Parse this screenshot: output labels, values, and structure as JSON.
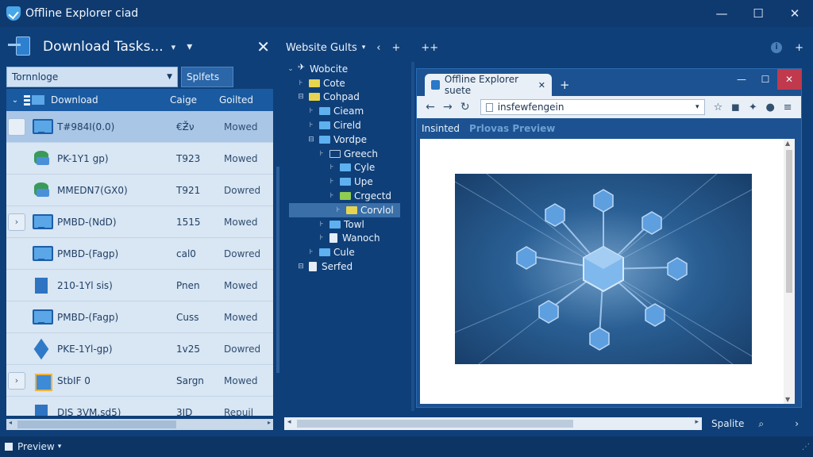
{
  "window": {
    "title": "Offline Explorer ciad",
    "controls": [
      "—",
      "☐",
      "✕"
    ]
  },
  "left_panel": {
    "title": "Download Tasks...",
    "dropdown_glyph": "▾",
    "more_glyph": "▾",
    "close_glyph": "✕",
    "filter_value": "Tornnloge",
    "status_button": "Splfets",
    "header": {
      "caret": "⌄",
      "name": "Download",
      "size": "Caige",
      "status": "Goilted"
    },
    "rows": [
      {
        "expander": "",
        "icon": "monitor",
        "name": "T#984I(0.0)",
        "size": "€Ƶ̌ν",
        "status": "Mowed",
        "selected": true
      },
      {
        "expander": "",
        "icon": "db",
        "name": "PK-1Y1 gp)",
        "size": "T923",
        "status": "Mowed",
        "selected": false
      },
      {
        "expander": "",
        "icon": "db",
        "name": "MMEDN7(GX0)",
        "size": "T921",
        "status": "Dowred",
        "selected": false
      },
      {
        "expander": "›",
        "icon": "monitor",
        "name": "PMBD-(NdD)",
        "size": "1515",
        "status": "Mowed",
        "selected": false
      },
      {
        "expander": "",
        "icon": "monitor",
        "name": "PMBD-(Fagp)",
        "size": "cal0",
        "status": "Dowred",
        "selected": false
      },
      {
        "expander": "",
        "icon": "doc",
        "name": "210-1Yl sis)",
        "size": "Pnen",
        "status": "Mowed",
        "selected": false
      },
      {
        "expander": "",
        "icon": "monitor",
        "name": "PMBD-(Fagp)",
        "size": "Cuss",
        "status": "Mowed",
        "selected": false
      },
      {
        "expander": "",
        "icon": "cube",
        "name": "PKE-1Yl-gp)",
        "size": "1v25",
        "status": "Dowred",
        "selected": false
      },
      {
        "expander": "›",
        "icon": "box",
        "name": "StbIF 0",
        "size": "Sargn",
        "status": "Mowed",
        "selected": false
      },
      {
        "expander": "",
        "icon": "doc",
        "name": "DIS 3VM.sd5)",
        "size": "3JD",
        "status": "Repuil",
        "selected": false
      }
    ]
  },
  "mid_toolbar": {
    "tab_label": "Website Gults",
    "dropdown_glyph": "▾",
    "back_glyph": "‹",
    "add_glyph": "+",
    "plusplus_glyph": "++",
    "info_glyph": "i",
    "add_right_glyph": "+"
  },
  "tree": [
    {
      "indent": 0,
      "expander": "⌄",
      "icon": "pin",
      "label": "Wobcite",
      "selected": false
    },
    {
      "indent": 1,
      "expander": "⊦",
      "icon": "y",
      "label": "Cote",
      "selected": false
    },
    {
      "indent": 1,
      "expander": "⊟",
      "icon": "y",
      "label": "Cohpad",
      "selected": false
    },
    {
      "indent": 2,
      "expander": "⊦",
      "icon": "b",
      "label": "Cieam",
      "selected": false
    },
    {
      "indent": 2,
      "expander": "⊦",
      "icon": "b",
      "label": "Cireld",
      "selected": false
    },
    {
      "indent": 2,
      "expander": "⊟",
      "icon": "b",
      "label": "Vordpe",
      "selected": false
    },
    {
      "indent": 3,
      "expander": "⊦",
      "icon": "o",
      "label": "Greech",
      "selected": false
    },
    {
      "indent": 4,
      "expander": "⊦",
      "icon": "b",
      "label": "Cyle",
      "selected": false
    },
    {
      "indent": 4,
      "expander": "⊦",
      "icon": "b",
      "label": "Upe",
      "selected": false
    },
    {
      "indent": 4,
      "expander": "⊦",
      "icon": "g",
      "label": "Crgectd",
      "selected": false
    },
    {
      "indent": 4,
      "expander": "⊦",
      "icon": "y",
      "label": "Corvlol",
      "selected": true
    },
    {
      "indent": 3,
      "expander": "⊦",
      "icon": "b",
      "label": "Towl",
      "selected": false
    },
    {
      "indent": 3,
      "expander": "⊦",
      "icon": "doc",
      "label": "Wanoch",
      "selected": false
    },
    {
      "indent": 2,
      "expander": "⊦",
      "icon": "b",
      "label": "Cule",
      "selected": false
    },
    {
      "indent": 1,
      "expander": "⊟",
      "icon": "doc",
      "label": "Serfed",
      "selected": false
    }
  ],
  "browser": {
    "tab_title": "Offline Explorer suete",
    "tab_close": "✕",
    "new_tab": "+",
    "controls": [
      "—",
      "☐",
      "✕"
    ],
    "url": "insfewfengein",
    "url_dropdown": "▾",
    "nav": {
      "back": "←",
      "forward": "→",
      "reload": "↻"
    },
    "tools": [
      "☆",
      "◼",
      "✦",
      "●",
      "≡"
    ],
    "subtabs": {
      "active": "Insinted",
      "inactive": "Prlovas Preview"
    }
  },
  "bottom": {
    "hscroll_left": "◂",
    "hscroll_right": "▸",
    "status_label": "Spalite",
    "search_glyph": "⌕",
    "next_glyph": "›"
  },
  "left_hscroll": {
    "left": "◂",
    "right": "▸"
  },
  "statusbar": {
    "label": "Preview",
    "dropdown": "▾",
    "grip": "⋰"
  },
  "colors": {
    "app_bg": "#0f3f78",
    "accent": "#2a78c8",
    "selection": "#a9c6e6",
    "close_red": "#c0394c"
  }
}
